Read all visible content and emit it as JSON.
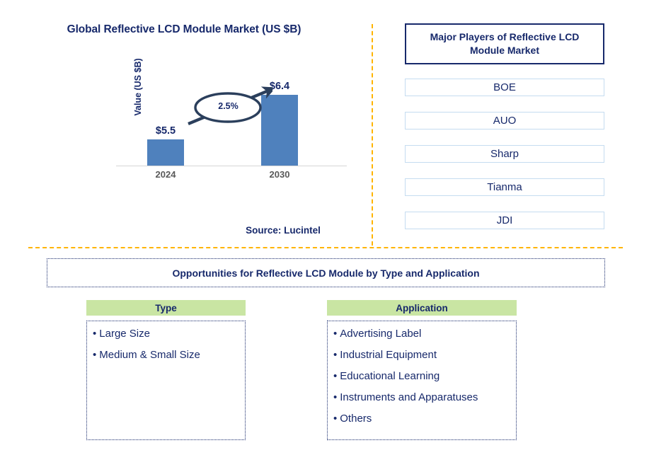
{
  "chart_panel": {
    "title": "Global Reflective LCD Module Market (US $B)",
    "y_axis_label": "Value (US $B)",
    "cagr_label": "2.5%",
    "value_2024": "$5.5",
    "value_2030": "$6.4",
    "tick_2024": "2024",
    "tick_2030": "2030"
  },
  "chart_data": {
    "type": "bar",
    "title": "Global Reflective LCD Module Market (US $B)",
    "categories": [
      "2024",
      "2030"
    ],
    "values": [
      5.5,
      6.4
    ],
    "data_labels": [
      "$5.5",
      "$6.4"
    ],
    "xlabel": "",
    "ylabel": "Value (US $B)",
    "ylim": [
      0,
      7.5
    ],
    "grid": false,
    "legend": "none",
    "bar_color": "#4f81bd",
    "annotations": [
      {
        "text": "2.5%",
        "kind": "cagr-ellipse-with-arrow",
        "from_category": "2024",
        "to_category": "2030"
      }
    ]
  },
  "source": {
    "text": "Source: Lucintel"
  },
  "players_panel": {
    "header": "Major Players of Reflective LCD Module Market",
    "items": [
      {
        "label": "BOE"
      },
      {
        "label": "AUO"
      },
      {
        "label": "Sharp"
      },
      {
        "label": "Tianma"
      },
      {
        "label": "JDI"
      }
    ]
  },
  "opportunities": {
    "title": "Opportunities for Reflective LCD Module by Type and Application",
    "columns": [
      {
        "header": "Type",
        "items": [
          "Large Size",
          "Medium & Small Size"
        ]
      },
      {
        "header": "Application",
        "items": [
          "Advertising Label",
          "Industrial Equipment",
          "Educational Learning",
          "Instruments and Apparatuses",
          "Others"
        ]
      }
    ]
  },
  "colors": {
    "navy": "#17296b",
    "bar_blue": "#4f81bd",
    "divider_orange": "#ffb400",
    "header_green": "#c9e5a3",
    "player_border": "#c5dcf0",
    "tick_grey": "#595959"
  },
  "bullet_glyph": "•"
}
